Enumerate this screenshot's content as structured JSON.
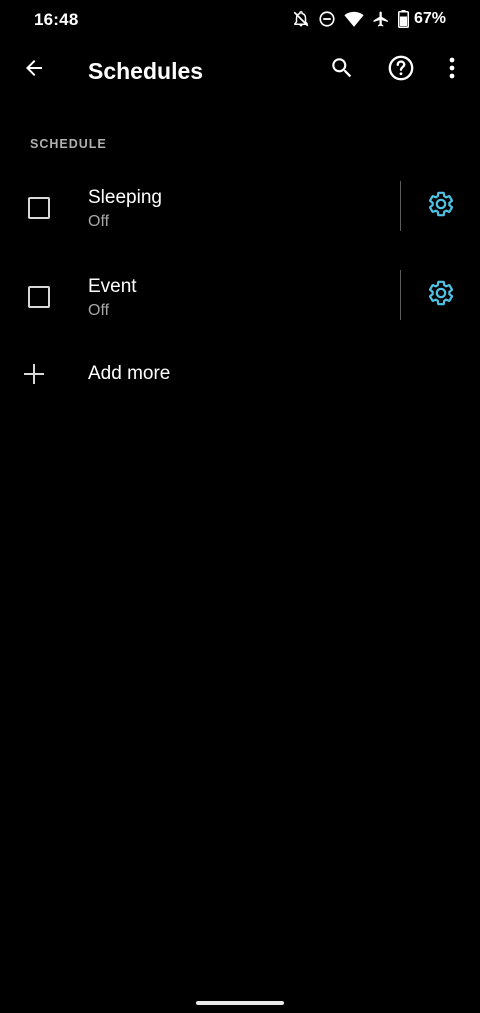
{
  "status_bar": {
    "time": "16:48",
    "battery_percent": "67%",
    "icons": [
      "notifications-off-icon",
      "do-not-disturb-icon",
      "wifi-icon",
      "airplane-mode-icon",
      "battery-icon"
    ]
  },
  "app_bar": {
    "title": "Schedules",
    "back_icon": "arrow-back-icon",
    "search_icon": "search-icon",
    "help_icon": "help-icon",
    "more_icon": "more-vert-icon"
  },
  "section": {
    "header": "SCHEDULE"
  },
  "schedules": [
    {
      "title": "Sleeping",
      "status": "Off",
      "checked": false
    },
    {
      "title": "Event",
      "status": "Off",
      "checked": false
    }
  ],
  "add_more": {
    "label": "Add more"
  },
  "colors": {
    "background": "#000000",
    "accent": "#4fc3e6",
    "text_primary": "#ffffff",
    "text_secondary": "#a8a8a8"
  }
}
